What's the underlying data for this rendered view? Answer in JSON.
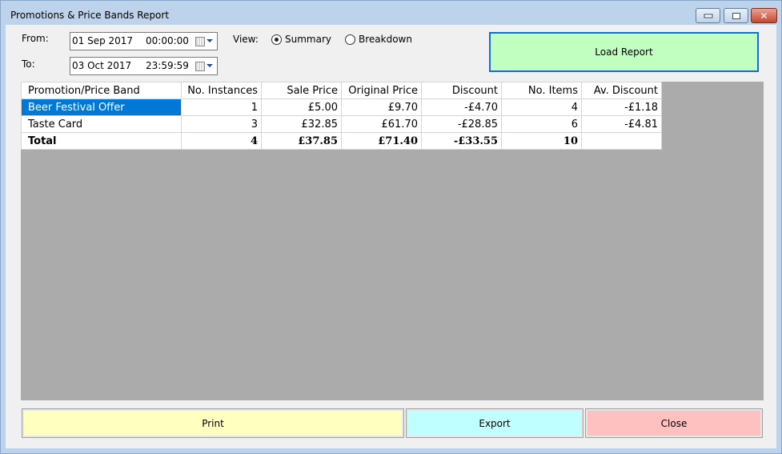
{
  "window": {
    "title": "Promotions & Price Bands Report",
    "controls": [
      "minimize",
      "maximize",
      "close"
    ]
  },
  "filters": {
    "from_label": "From:",
    "from_date": "01 Sep 2017",
    "from_time": "00:00:00",
    "to_label": "To:",
    "to_date": "03 Oct 2017",
    "to_time": "23:59:59",
    "view_label": "View:",
    "view_options": [
      {
        "label": "Summary",
        "selected": true
      },
      {
        "label": "Breakdown",
        "selected": false
      }
    ]
  },
  "load_report_label": "Load Report",
  "table": {
    "columns": [
      "Promotion/Price Band",
      "No. Instances",
      "Sale Price",
      "Original Price",
      "Discount",
      "No. Items",
      "Av. Discount"
    ],
    "rows": [
      [
        "Beer Festival Offer",
        "1",
        "£5.00",
        "£9.70",
        "-£4.70",
        "4",
        "-£1.18"
      ],
      [
        "Taste Card",
        "3",
        "£32.85",
        "£61.70",
        "-£28.85",
        "6",
        "-£4.81"
      ]
    ],
    "total": [
      "Total",
      "4",
      "£37.85",
      "£71.40",
      "-£33.55",
      "10",
      ""
    ],
    "selected_row": 0
  },
  "buttons": {
    "print": "Print",
    "export": "Export",
    "close": "Close"
  },
  "colors": {
    "load_bg": "#c0ffc0",
    "load_border": "#0f6fd6",
    "print_bg": "#ffffc0",
    "export_bg": "#c0ffff",
    "close_bg": "#ffc0c0",
    "selection": "#0078d7"
  }
}
